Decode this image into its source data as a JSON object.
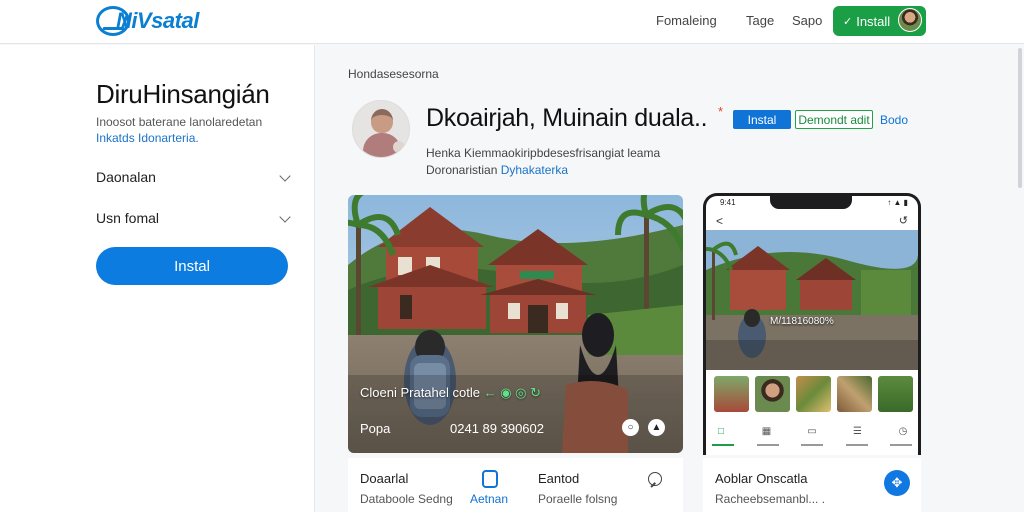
{
  "header": {
    "logo_text": "NiVsatal",
    "nav": [
      "Fomaleing",
      "Tage",
      "Sapo"
    ],
    "install_label": "Install",
    "install_icon": "download-icon"
  },
  "sidebar": {
    "title": "DiruHinsangián",
    "desc_line1": "Inoosot baterane lanolaredetan",
    "desc_line2": "Inkatds Idonarteria.",
    "accordions": [
      {
        "label": "Daonalan"
      },
      {
        "label": "Usn fomal"
      }
    ],
    "install_button": "Instal"
  },
  "main": {
    "breadcrumb": "Hondasesesorna",
    "profile_name": "Dkoairjah, Muinain duala..",
    "star": "*",
    "btn_primary": "Instal",
    "btn_secondary": "Demondt adit",
    "btn_link": "Bodo",
    "meta_line1": "Henka Kiemmaokiripbdesesfrisangiat leama",
    "meta_line2_text": "Doronaristian",
    "meta_line2_link": "Dyhakaterka"
  },
  "photo_card": {
    "caption_main": "Cloeni Pratahel cotle",
    "caption_green": "← ◉ ◎ ↻",
    "label": "Popa",
    "number": "0241 89 390602",
    "icons": [
      "share-icon",
      "bookmark-icon"
    ],
    "footer": [
      {
        "title": "Doaarlal",
        "subtitle": "Databoole Sedng"
      },
      {
        "title": "",
        "subtitle": "Aetnan"
      },
      {
        "title": "Eantod",
        "subtitle": "Poraelle folsng"
      }
    ]
  },
  "phone": {
    "time": "9:41",
    "status": "↑ ▲ ▮",
    "back": "<",
    "share": "↺",
    "label": "M/11816080%",
    "tabs": [
      "home-icon",
      "grid-icon",
      "chat-icon",
      "list-icon",
      "clock-icon"
    ],
    "card_title": "Aoblar Onscatla",
    "card_subtitle": "Racheebsemanbl... .",
    "card_button_icon": "move-icon"
  },
  "colors": {
    "brand": "#0b7fd1",
    "primary": "#0c7ce0",
    "success": "#1a9e46"
  }
}
